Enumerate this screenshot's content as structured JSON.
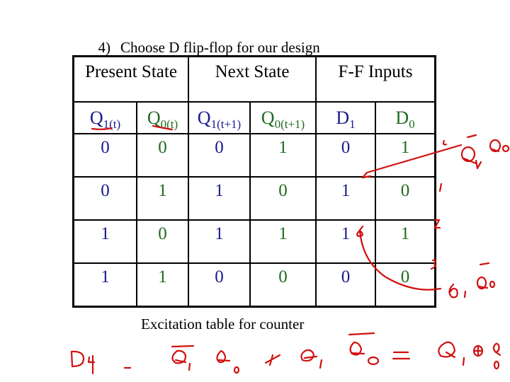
{
  "heading": {
    "number": "4)",
    "text": "Choose D flip-flop for our design"
  },
  "table": {
    "group_headers": [
      "Present State",
      "Next State",
      "F-F Inputs"
    ],
    "sub_headers": [
      {
        "base": "Q",
        "sub": "1(t)",
        "color": "#1a1a8c"
      },
      {
        "base": "Q",
        "sub": "0(t)",
        "color": "#1f6b1f"
      },
      {
        "base": "Q",
        "sub": "1(t+1)",
        "color": "#1a1a8c"
      },
      {
        "base": "Q",
        "sub": "0(t+1)",
        "color": "#1f6b1f"
      },
      {
        "base": "D",
        "sub": "1",
        "color": "#1a1a8c"
      },
      {
        "base": "D",
        "sub": "0",
        "color": "#1f6b1f"
      }
    ],
    "rows": [
      [
        "0",
        "0",
        "0",
        "1",
        "0",
        "1"
      ],
      [
        "0",
        "1",
        "1",
        "0",
        "1",
        "0"
      ],
      [
        "1",
        "0",
        "1",
        "1",
        "1",
        "1"
      ],
      [
        "1",
        "1",
        "0",
        "0",
        "0",
        "0"
      ]
    ]
  },
  "caption": "Excitation table for counter",
  "annotations": {
    "color": "#d01010",
    "row_indices": [
      "0",
      "1",
      "2",
      "3"
    ],
    "minterm_row1": "Q̄1 Q0",
    "minterm_row2": "Q1 Q̄0",
    "equation": "D1 = Q̄1 Q0 + Q1 Q̄0 = Q1 ⊕ Q0"
  }
}
